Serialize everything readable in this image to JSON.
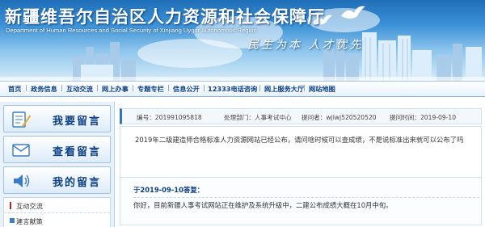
{
  "banner": {
    "title": "新疆维吾尔自治区人力资源和社会保障厅",
    "subtitle": "Department of Human Resources and Social Security of Xinjiang Uygur Autonomous Region",
    "slogan": "民生为本  人才优先"
  },
  "nav": {
    "items": [
      {
        "label": "首页"
      },
      {
        "label": "政务信息"
      },
      {
        "label": "互动交流"
      },
      {
        "label": "网上办事"
      },
      {
        "label": "专题专栏"
      },
      {
        "label": "信息公开"
      },
      {
        "label": "12333电话咨询"
      },
      {
        "label": "网上服务大厅"
      },
      {
        "label": "网站地图"
      }
    ]
  },
  "sidebar": {
    "buttons": [
      {
        "label": "我要留言",
        "icon": "pencil-notepad-icon"
      },
      {
        "label": "查看留言",
        "icon": "mail-envelope-icon"
      },
      {
        "label": "我的留言",
        "icon": "speaker-icon"
      }
    ],
    "list": [
      {
        "label": "互动交流"
      },
      {
        "label": "建言献策"
      }
    ]
  },
  "message": {
    "number_label": "编号：",
    "number": "201991095818",
    "department_label": "处理部门：",
    "department": "人事考试中心",
    "user_label": "提问者：",
    "user": "wjlwj520520520",
    "date_label": "提问时间：",
    "date": "2019-09-10",
    "question": "2019年二级建造师合格标准人力资源网站已经公布，请问啥时候可以查成绩，不是说标准出来就可以公布了吗"
  },
  "answer": {
    "heading": "于2019-09-10答复：",
    "text": "你好，目前新疆人事考试网站正在维护及系统升级中，二建公布成绩大概在10月中旬。"
  },
  "colors": {
    "nav_text": "#0b3f86",
    "banner_top": "#1f6fb8",
    "accent": "#2f74c0"
  }
}
